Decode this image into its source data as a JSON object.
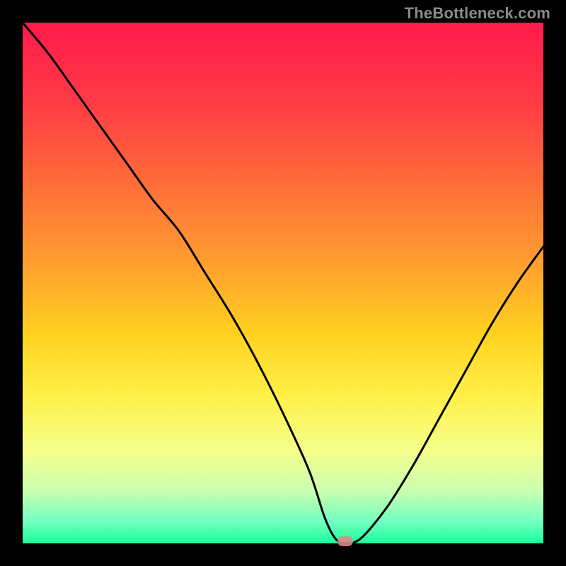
{
  "watermark": "TheBottleneck.com",
  "chart_data": {
    "type": "line",
    "title": "",
    "xlabel": "",
    "ylabel": "",
    "xlim": [
      0,
      100
    ],
    "ylim": [
      0,
      100
    ],
    "x": [
      0,
      5,
      10,
      15,
      20,
      25,
      30,
      35,
      40,
      45,
      50,
      55,
      58,
      60,
      62,
      65,
      70,
      75,
      80,
      85,
      90,
      95,
      100
    ],
    "values": [
      100,
      94,
      87,
      80,
      73,
      66,
      60,
      52,
      44,
      35,
      25,
      14,
      5,
      1,
      0,
      1,
      7,
      15,
      24,
      33,
      42,
      50,
      57
    ],
    "marker_x": 62,
    "marker_y": 0,
    "gradient_stops": [
      {
        "offset": 0.0,
        "color": "#ff1a4b"
      },
      {
        "offset": 0.15,
        "color": "#ff3a45"
      },
      {
        "offset": 0.3,
        "color": "#ff6a3a"
      },
      {
        "offset": 0.45,
        "color": "#ff9a30"
      },
      {
        "offset": 0.6,
        "color": "#ffd21f"
      },
      {
        "offset": 0.72,
        "color": "#fff14a"
      },
      {
        "offset": 0.82,
        "color": "#f6ff8a"
      },
      {
        "offset": 0.9,
        "color": "#c9ffb0"
      },
      {
        "offset": 0.96,
        "color": "#6fffc0"
      },
      {
        "offset": 1.0,
        "color": "#17ff9a"
      }
    ]
  }
}
